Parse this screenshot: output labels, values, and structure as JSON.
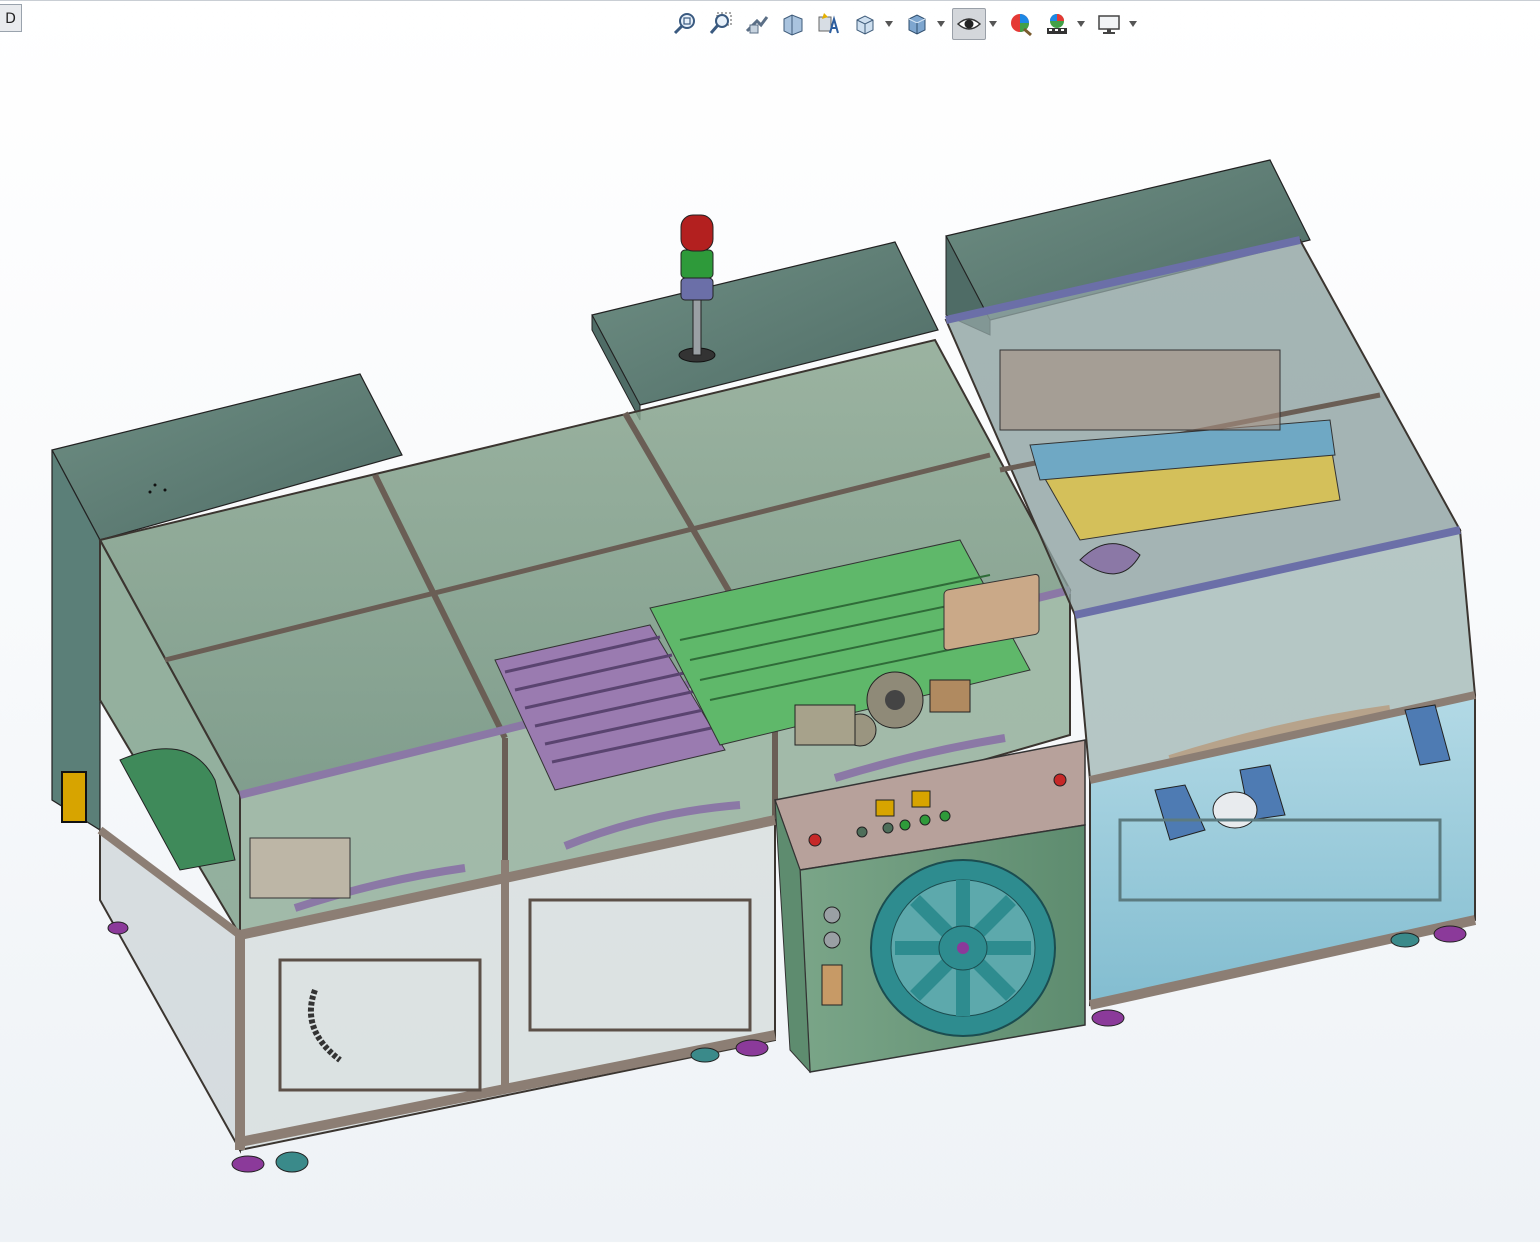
{
  "corner_tab": {
    "label": "D"
  },
  "toolbar": {
    "buttons": [
      {
        "icon": "zoom-to-fit-icon",
        "active": false
      },
      {
        "icon": "zoom-to-area-icon",
        "active": false
      },
      {
        "icon": "previous-view-icon",
        "active": false
      },
      {
        "icon": "section-view-icon",
        "active": false
      },
      {
        "icon": "dynamic-annotation-icon",
        "active": false
      },
      {
        "icon": "view-orientation-icon",
        "active": false
      },
      {
        "icon": "display-style-icon",
        "active": false
      },
      {
        "icon": "hide-show-items-icon",
        "active": true
      },
      {
        "icon": "edit-appearance-icon",
        "active": false
      },
      {
        "icon": "apply-scene-icon",
        "active": false
      },
      {
        "icon": "view-settings-icon",
        "active": false
      }
    ]
  },
  "colors": {
    "frame": "#8c7e74",
    "frame_dark": "#5c5048",
    "glass": "#7f9c86",
    "panel_dark": "#5e7d73",
    "cabinet": "#6e9a7e",
    "purple": "#8b78a6",
    "teal_wheel": "#2e8c8f",
    "blue_unit": "#8ec6d8",
    "beacon_red": "#b3201f",
    "beacon_green": "#2e9a3a",
    "beacon_blue": "#6b6fa8"
  }
}
